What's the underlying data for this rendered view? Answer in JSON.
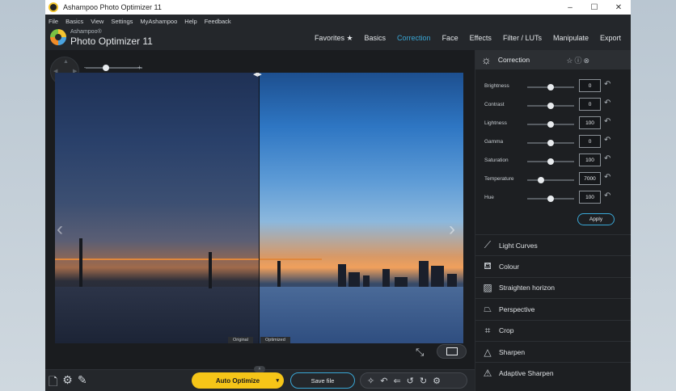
{
  "window": {
    "title": "Ashampoo Photo Optimizer 11",
    "controls": [
      "–",
      "☐",
      "✕"
    ]
  },
  "menu": [
    "File",
    "Basics",
    "View",
    "Settings",
    "MyAshampoo",
    "Help",
    "Feedback"
  ],
  "brand": {
    "small": "Ashampoo®",
    "big": "Photo Optimizer 11"
  },
  "nav": {
    "items": [
      {
        "label": "Favorites ★"
      },
      {
        "label": "Basics"
      },
      {
        "label": "Correction"
      },
      {
        "label": "Face"
      },
      {
        "label": "Effects"
      },
      {
        "label": "Filter / LUTs"
      },
      {
        "label": "Manipulate"
      },
      {
        "label": "Export"
      }
    ],
    "active": "Correction",
    "accent": "#3aa7d6"
  },
  "viewer": {
    "zoom_minus": "–",
    "zoom_plus": "+",
    "zoom_level": 0.35,
    "label_original": "Original",
    "label_optimized": "Optimized",
    "prev_arrow": "‹",
    "next_arrow": "›"
  },
  "bottom": {
    "auto_optimize": "Auto Optimize",
    "auto_caret": "▾",
    "save_file": "Save file",
    "expand": "˄"
  },
  "panel": {
    "title": "Correction",
    "head_icons": "☆ⓘ⊗",
    "adjustments": [
      {
        "label": "Brightness",
        "value": "0",
        "pos": 0.5
      },
      {
        "label": "Contrast",
        "value": "0",
        "pos": 0.5
      },
      {
        "label": "Lightness",
        "value": "100",
        "pos": 0.5
      },
      {
        "label": "Gamma",
        "value": "0",
        "pos": 0.5
      },
      {
        "label": "Saturation",
        "value": "100",
        "pos": 0.5
      },
      {
        "label": "Temperature",
        "value": "7000",
        "pos": 0.3
      },
      {
        "label": "Hue",
        "value": "100",
        "pos": 0.5
      }
    ],
    "apply": "Apply",
    "tools": [
      {
        "label": "Light Curves",
        "icon": "curve-icon"
      },
      {
        "label": "Colour",
        "icon": "bucket-icon"
      },
      {
        "label": "Straighten horizon",
        "icon": "image-icon"
      },
      {
        "label": "Perspective",
        "icon": "perspective-icon"
      },
      {
        "label": "Crop",
        "icon": "crop-icon"
      },
      {
        "label": "Sharpen",
        "icon": "triangle-icon"
      },
      {
        "label": "Adaptive Sharpen",
        "icon": "triangle-icon"
      }
    ]
  }
}
